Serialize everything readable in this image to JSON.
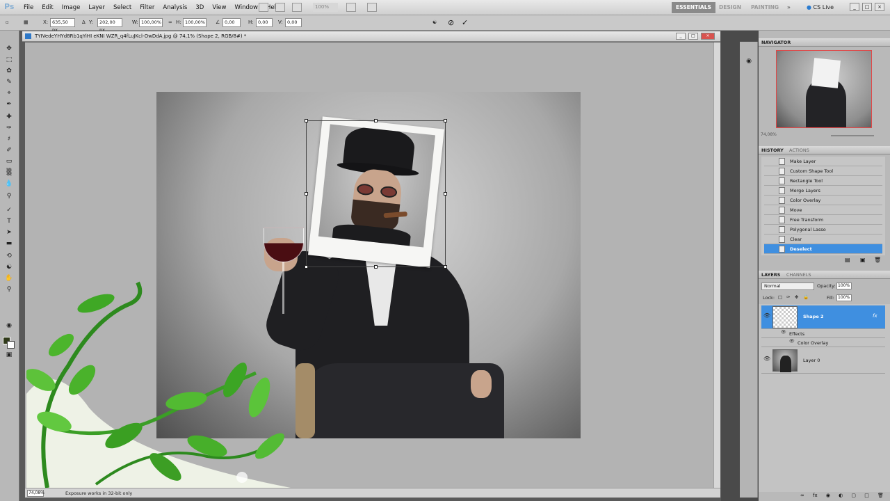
{
  "app": {
    "logo": "Ps"
  },
  "menu": [
    "File",
    "Edit",
    "Image",
    "Layer",
    "Select",
    "Filter",
    "Analysis",
    "3D",
    "View",
    "Window",
    "Help"
  ],
  "toolbar": {
    "zoom_value": "100%"
  },
  "workspaces": {
    "active": "ESSENTIALS",
    "design": "DESIGN",
    "painting": "PAINTING",
    "more": "»"
  },
  "cslive": "CS Live",
  "options": {
    "x_label": "X:",
    "x_value": "635,50 px",
    "y_label": "Y:",
    "y_value": "202,00 px",
    "w_label": "W:",
    "w_value": "100,00%",
    "h_label": "H:",
    "h_value": "100,00%",
    "angle_value": "0,00",
    "hskew_label": "H:",
    "hskew_value": "0,00",
    "vskew_label": "V:",
    "vskew_value": "0,00"
  },
  "document": {
    "title": "TYIVedeYHYd8Rb1qYiHI eKNI WZR_q4fLuJKcl-OwDdA.jpg @ 74,1% (Shape 2, RGB/8#) *",
    "zoom": "74,08%",
    "status": "Exposure works in 32-bit only"
  },
  "navigator": {
    "tab": "NAVIGATOR",
    "zoom": "74,08%"
  },
  "history": {
    "tab": "HISTORY",
    "other_tab": "ACTIONS",
    "items": [
      {
        "label": "Make Layer",
        "icon": "layer-icon",
        "selected": false
      },
      {
        "label": "Custom Shape Tool",
        "icon": "shape-icon",
        "selected": false
      },
      {
        "label": "Rectangle Tool",
        "icon": "rectangle-icon",
        "selected": false
      },
      {
        "label": "Merge Layers",
        "icon": "merge-icon",
        "selected": false
      },
      {
        "label": "Color Overlay",
        "icon": "fx-icon",
        "selected": false
      },
      {
        "label": "Move",
        "icon": "move-icon",
        "selected": false
      },
      {
        "label": "Free Transform",
        "icon": "transform-icon",
        "selected": false
      },
      {
        "label": "Polygonal Lasso",
        "icon": "lasso-icon",
        "selected": false
      },
      {
        "label": "Clear",
        "icon": "clear-icon",
        "selected": false
      },
      {
        "label": "Deselect",
        "icon": "deselect-icon",
        "selected": true
      }
    ]
  },
  "layers_panel": {
    "tab": "LAYERS",
    "other_tab": "CHANNELS",
    "blend_mode": "Normal",
    "opacity_label": "Opacity:",
    "opacity_value": "100%",
    "lock_label": "Lock:",
    "fill_label": "Fill:",
    "fill_value": "100%",
    "layers": [
      {
        "name": "Shape 2",
        "selected": true,
        "fx": "fx",
        "effects_label": "Effects",
        "effect_item": "Color Overlay"
      },
      {
        "name": "Layer 0",
        "selected": false
      }
    ]
  }
}
